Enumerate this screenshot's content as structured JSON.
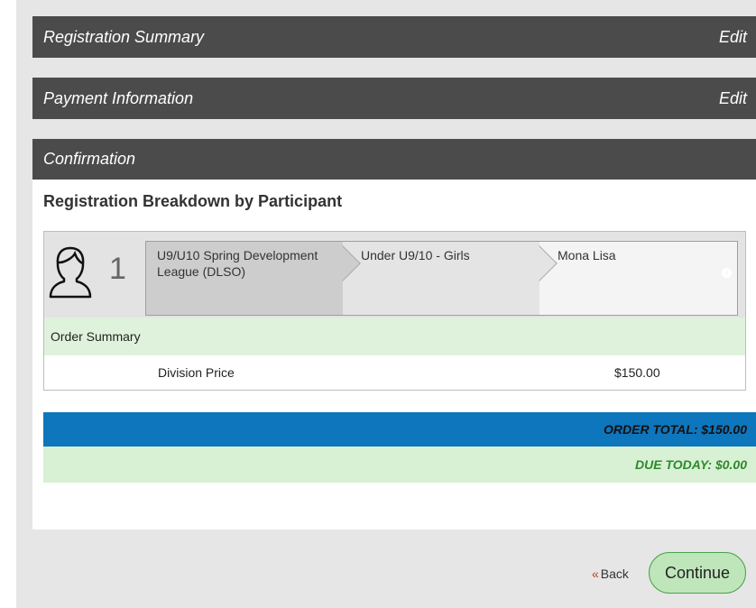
{
  "sections": {
    "summary": {
      "title": "Registration Summary",
      "edit_label": "Edit"
    },
    "payment": {
      "title": "Payment Information",
      "edit_label": "Edit"
    },
    "confirmation": {
      "title": "Confirmation"
    }
  },
  "confirmation": {
    "breakdown_title": "Registration Breakdown by Participant",
    "participant": {
      "number": "1",
      "icon": "user-outline-icon",
      "crumbs": [
        "U9/U10 Spring Development League (DLSO)",
        "Under U9/10 - Girls",
        "Mona Lisa"
      ],
      "info_icon": "info-icon"
    },
    "order_summary_label": "Order Summary",
    "line_items": [
      {
        "description": "Division Price",
        "price": "$150.00"
      }
    ],
    "order_total": "ORDER TOTAL: $150.00",
    "due_today": "DUE TODAY: $0.00"
  },
  "actions": {
    "back_label": "Back",
    "continue_label": "Continue"
  },
  "colors": {
    "section_bar": "#4b4b4b",
    "total_bar": "#0e76bd",
    "due_bar": "#d8f0d3",
    "order_summary": "#dff2dc",
    "continue_button": "#bfe6bb"
  }
}
